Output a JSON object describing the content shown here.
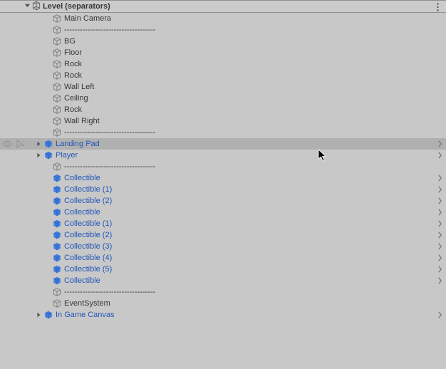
{
  "scene": {
    "title": "Level (separators)"
  },
  "items": [
    {
      "label": "Main Camera",
      "depth": 1,
      "prefab": false,
      "foldout": "",
      "chev": false,
      "selected": false
    },
    {
      "label": "-----------------------------------",
      "depth": 1,
      "prefab": false,
      "foldout": "",
      "chev": false,
      "selected": false
    },
    {
      "label": "BG",
      "depth": 1,
      "prefab": false,
      "foldout": "",
      "chev": false,
      "selected": false
    },
    {
      "label": "Floor",
      "depth": 1,
      "prefab": false,
      "foldout": "",
      "chev": false,
      "selected": false
    },
    {
      "label": "Rock",
      "depth": 1,
      "prefab": false,
      "foldout": "",
      "chev": false,
      "selected": false
    },
    {
      "label": "Rock",
      "depth": 1,
      "prefab": false,
      "foldout": "",
      "chev": false,
      "selected": false
    },
    {
      "label": "Wall Left",
      "depth": 1,
      "prefab": false,
      "foldout": "",
      "chev": false,
      "selected": false
    },
    {
      "label": "Ceiling",
      "depth": 1,
      "prefab": false,
      "foldout": "",
      "chev": false,
      "selected": false
    },
    {
      "label": "Rock",
      "depth": 1,
      "prefab": false,
      "foldout": "",
      "chev": false,
      "selected": false
    },
    {
      "label": "Wall Right",
      "depth": 1,
      "prefab": false,
      "foldout": "",
      "chev": false,
      "selected": false
    },
    {
      "label": "-----------------------------------",
      "depth": 1,
      "prefab": false,
      "foldout": "",
      "chev": false,
      "selected": false
    },
    {
      "label": "Landing Pad",
      "depth": 0,
      "prefab": true,
      "foldout": "right",
      "chev": true,
      "selected": true
    },
    {
      "label": "Player",
      "depth": 0,
      "prefab": true,
      "foldout": "right",
      "chev": true,
      "selected": false
    },
    {
      "label": "-----------------------------------",
      "depth": 1,
      "prefab": false,
      "foldout": "",
      "chev": false,
      "selected": false
    },
    {
      "label": "Collectible",
      "depth": 1,
      "prefab": true,
      "foldout": "",
      "chev": true,
      "selected": false
    },
    {
      "label": "Collectible (1)",
      "depth": 1,
      "prefab": true,
      "foldout": "",
      "chev": true,
      "selected": false
    },
    {
      "label": "Collectible (2)",
      "depth": 1,
      "prefab": true,
      "foldout": "",
      "chev": true,
      "selected": false
    },
    {
      "label": "Collectible",
      "depth": 1,
      "prefab": true,
      "foldout": "",
      "chev": true,
      "selected": false
    },
    {
      "label": "Collectible (1)",
      "depth": 1,
      "prefab": true,
      "foldout": "",
      "chev": true,
      "selected": false
    },
    {
      "label": "Collectible (2)",
      "depth": 1,
      "prefab": true,
      "foldout": "",
      "chev": true,
      "selected": false
    },
    {
      "label": "Collectible (3)",
      "depth": 1,
      "prefab": true,
      "foldout": "",
      "chev": true,
      "selected": false
    },
    {
      "label": "Collectible (4)",
      "depth": 1,
      "prefab": true,
      "foldout": "",
      "chev": true,
      "selected": false
    },
    {
      "label": "Collectible (5)",
      "depth": 1,
      "prefab": true,
      "foldout": "",
      "chev": true,
      "selected": false
    },
    {
      "label": "Collectible",
      "depth": 1,
      "prefab": true,
      "foldout": "",
      "chev": true,
      "selected": false
    },
    {
      "label": "-----------------------------------",
      "depth": 1,
      "prefab": false,
      "foldout": "",
      "chev": false,
      "selected": false
    },
    {
      "label": "EventSystem",
      "depth": 1,
      "prefab": false,
      "foldout": "",
      "chev": false,
      "selected": false
    },
    {
      "label": "In Game Canvas",
      "depth": 0,
      "prefab": true,
      "foldout": "right",
      "chev": true,
      "selected": false
    }
  ]
}
